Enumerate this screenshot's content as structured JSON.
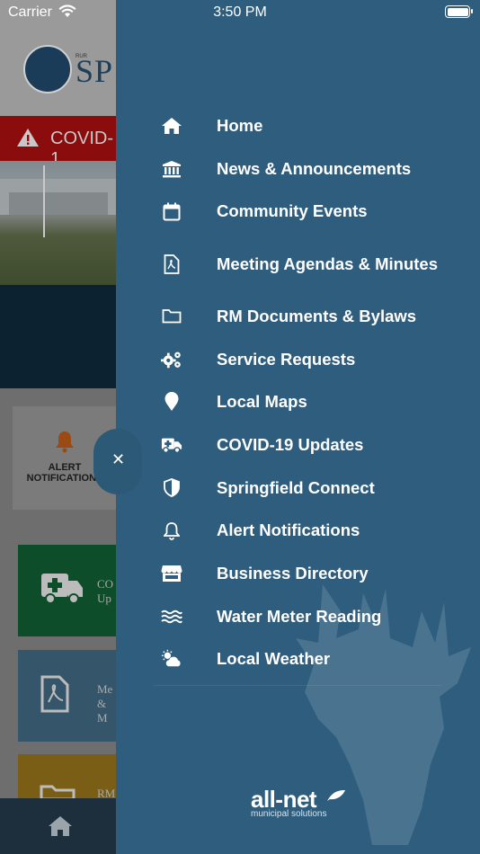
{
  "status_bar": {
    "carrier": "Carrier",
    "time": "3:50 PM"
  },
  "background_app": {
    "logo_text": "SP",
    "logo_small": "RUR",
    "alert_banner": "COVID-1",
    "alert_card": {
      "line1": "ALERT",
      "line2": "NOTIFICATIONS"
    },
    "tiles": [
      {
        "line1": "CO",
        "line2": "Up"
      },
      {
        "line1": "Me",
        "line2": "& M"
      },
      {
        "line1": "RM",
        "line2": ""
      }
    ]
  },
  "menu": {
    "items": [
      {
        "label": "Home",
        "icon": "home-icon"
      },
      {
        "label": "News & Announcements",
        "icon": "bank-icon"
      },
      {
        "label": "Community Events",
        "icon": "calendar-icon"
      },
      {
        "label": "Meeting Agendas & Minutes",
        "icon": "pdf-file-icon"
      },
      {
        "label": "RM Documents & Bylaws",
        "icon": "folder-icon"
      },
      {
        "label": "Service Requests",
        "icon": "gears-icon"
      },
      {
        "label": "Local Maps",
        "icon": "map-pin-icon"
      },
      {
        "label": "COVID-19 Updates",
        "icon": "ambulance-icon"
      },
      {
        "label": "Springfield Connect",
        "icon": "shield-icon"
      },
      {
        "label": "Alert Notifications",
        "icon": "bell-icon"
      },
      {
        "label": "Business Directory",
        "icon": "store-icon"
      },
      {
        "label": "Water Meter Reading",
        "icon": "water-icon"
      },
      {
        "label": "Local Weather",
        "icon": "weather-icon"
      }
    ],
    "brand": {
      "name": "all-net",
      "tagline": "municipal solutions"
    }
  },
  "colors": {
    "menu_bg": "#2f5d7d",
    "alert_red": "#8a0c0c",
    "text": "#ffffff"
  }
}
